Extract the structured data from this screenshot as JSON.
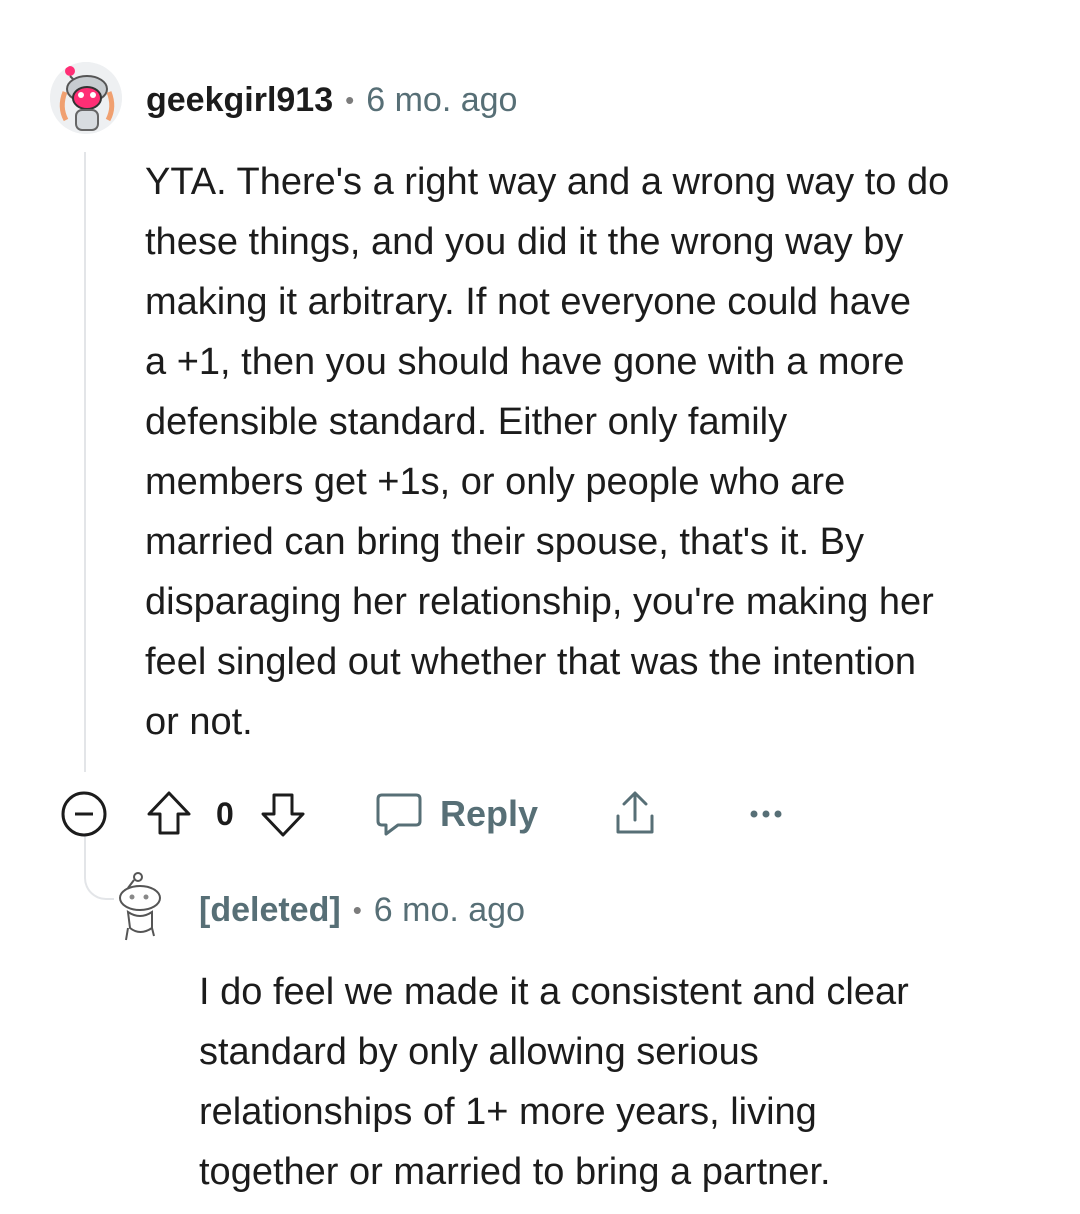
{
  "comment": {
    "username": "geekgirl913",
    "separator": "•",
    "time": "6 mo. ago",
    "avatar_icon": "snoo-avatar-icon",
    "lines": [
      "YTA. There's a right way and a wrong way to do",
      "these things, and you did it the wrong way by",
      "making it arbitrary. If not everyone could have",
      "a +1, then you should have gone with a more",
      "defensible standard. Either only family",
      "members get +1s, or only people who are",
      "married can bring their spouse, that's it. By",
      "disparaging her relationship, you're making her",
      "feel singled out whether that was the intention",
      "or not."
    ]
  },
  "actions": {
    "collapse_icon": "collapse-minus-icon",
    "upvote_icon": "upvote-arrow-icon",
    "vote_count": "0",
    "downvote_icon": "downvote-arrow-icon",
    "reply_icon": "comment-bubble-icon",
    "reply_label": "Reply",
    "share_icon": "share-icon",
    "more_icon": "more-dots-icon"
  },
  "reply": {
    "username": "[deleted]",
    "separator": "•",
    "time": "6 mo. ago",
    "avatar_icon": "deleted-snoo-avatar-icon",
    "lines": [
      "I do feel we made it a consistent and clear",
      "standard by only allowing serious",
      "relationships of 1+ more years, living",
      "together or married to bring a partner."
    ]
  },
  "colors": {
    "text": "#1c1c1c",
    "meta": "#576f76",
    "thread_line": "#e3e5e8",
    "avatar_accent": "#ff2e75"
  }
}
